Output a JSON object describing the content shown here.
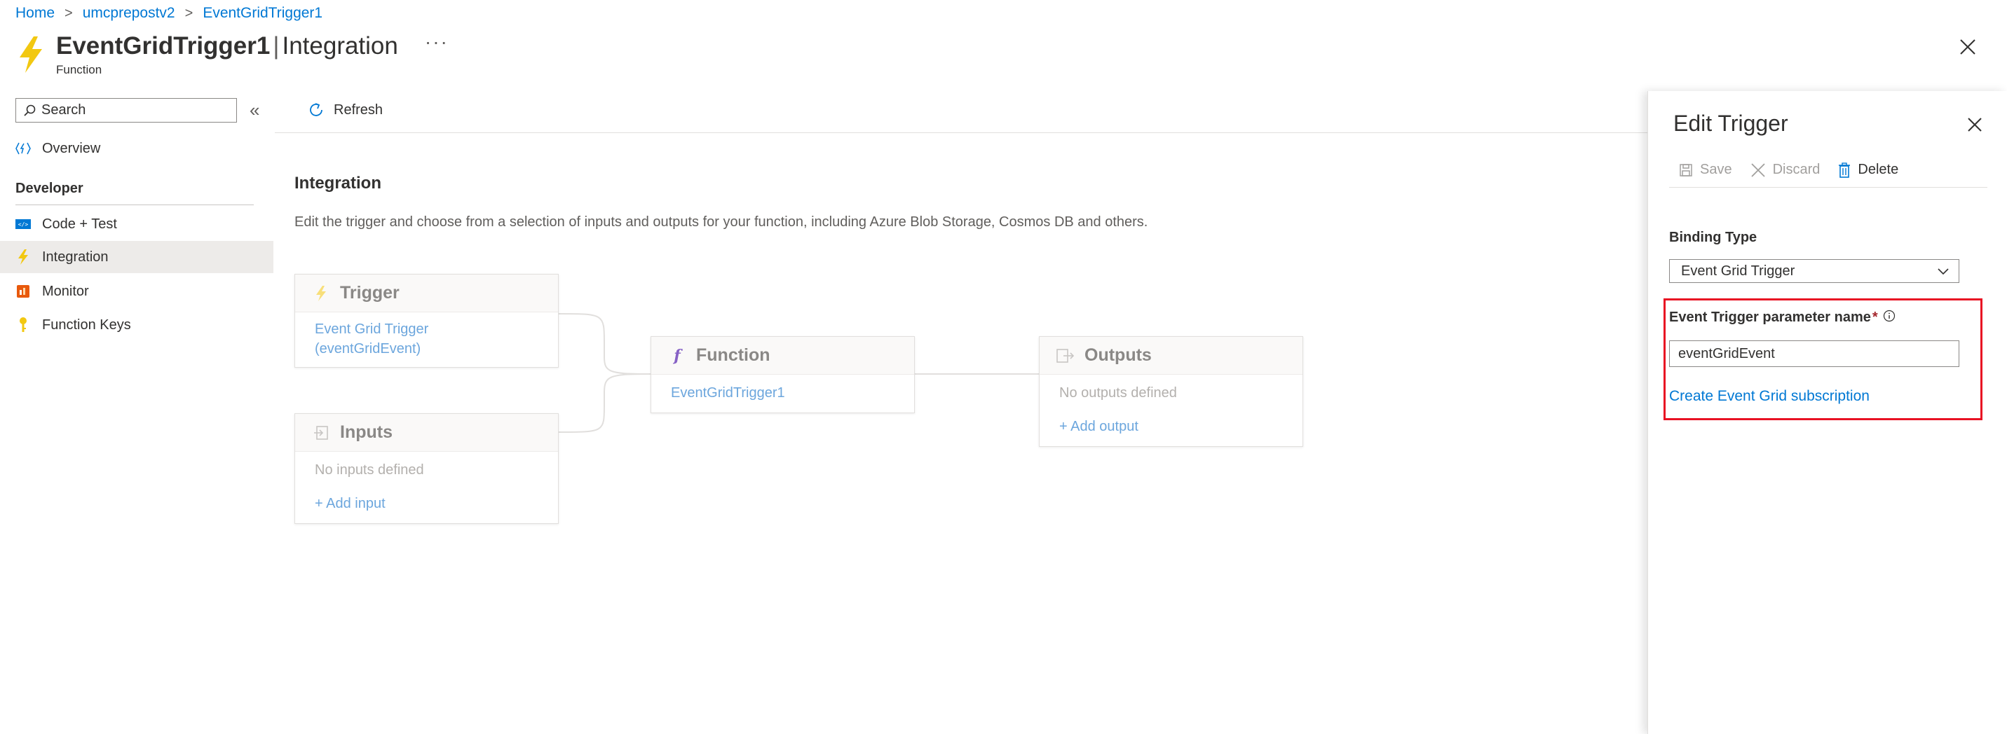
{
  "breadcrumb": {
    "items": [
      "Home",
      "umcprepostv2",
      "EventGridTrigger1"
    ],
    "separator": ">"
  },
  "header": {
    "function_name": "EventGridTrigger1",
    "divider": "|",
    "page_name": "Integration",
    "subtitle": "Function",
    "more": "···"
  },
  "sidebar": {
    "search_placeholder": "Search",
    "collapse_glyph": "«",
    "overview_label": "Overview",
    "section_header": "Developer",
    "items": [
      {
        "label": "Code + Test",
        "icon": "code-icon"
      },
      {
        "label": "Integration",
        "icon": "lightning-icon",
        "active": true
      },
      {
        "label": "Monitor",
        "icon": "monitor-icon"
      },
      {
        "label": "Function Keys",
        "icon": "key-icon"
      }
    ]
  },
  "toolbar": {
    "refresh_label": "Refresh"
  },
  "main": {
    "title": "Integration",
    "description": "Edit the trigger and choose from a selection of inputs and outputs for your function, including Azure Blob Storage, Cosmos DB and others."
  },
  "diagram": {
    "trigger": {
      "title": "Trigger",
      "link_line1": "Event Grid Trigger",
      "link_line2": "(eventGridEvent)"
    },
    "inputs": {
      "title": "Inputs",
      "empty": "No inputs defined",
      "add": "+ Add input"
    },
    "function": {
      "title": "Function",
      "link": "EventGridTrigger1"
    },
    "outputs": {
      "title": "Outputs",
      "empty": "No outputs defined",
      "add": "+ Add output"
    }
  },
  "edit_panel": {
    "title": "Edit Trigger",
    "save_label": "Save",
    "discard_label": "Discard",
    "delete_label": "Delete",
    "binding_type_label": "Binding Type",
    "binding_type_value": "Event Grid Trigger",
    "param_label": "Event Trigger parameter name",
    "required_mark": "*",
    "param_value": "eventGridEvent",
    "create_link": "Create Event Grid subscription"
  },
  "colors": {
    "accent": "#0078d4",
    "highlight": "#e81123",
    "lightning": "#f2c811"
  }
}
